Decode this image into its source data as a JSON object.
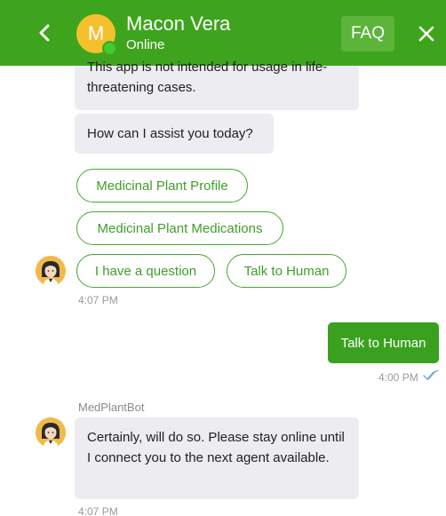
{
  "header": {
    "avatar_letter": "M",
    "contact_name": "Macon Vera",
    "status": "Online",
    "faq_label": "FAQ"
  },
  "messages": {
    "intro_cut": "This app is not intended for usage in life-threatening cases.",
    "question": "How can I assist you today?",
    "quick_replies": [
      "Medicinal Plant Profile",
      "Medicinal Plant Medications",
      "I have a question",
      "Talk to Human"
    ],
    "time_1": "4:07 PM",
    "user_message": "Talk to Human",
    "user_time": "4:00 PM",
    "bot_sender": "MedPlantBot",
    "bot_reply": "Certainly, will do so. Please stay online until I connect you to the next agent available.",
    "time_2": "4:07 PM"
  },
  "colors": {
    "brand_green": "#3fa41d",
    "avatar_yellow": "#f5c02e",
    "bubble_grey": "#ececf1",
    "read_check_blue": "#6aa6e6"
  },
  "icons": {
    "back": "chevron-left-icon",
    "close": "close-icon",
    "bot_avatar": "bot-avatar-icon",
    "read_receipt": "double-check-icon"
  }
}
